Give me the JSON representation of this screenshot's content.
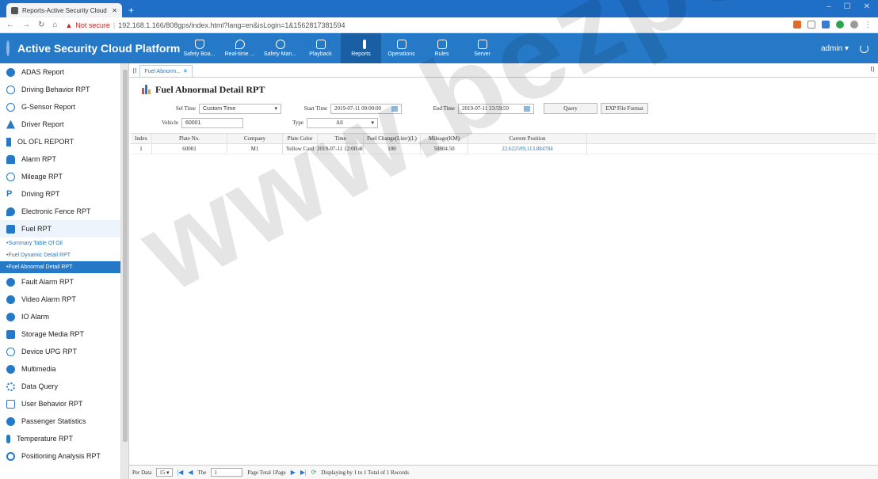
{
  "browser": {
    "tab_title": "Reports-Active Security Cloud",
    "url_warning": "Not secure",
    "url": "192.168.1.166/808gps/index.html?lang=en&isLogin=1&1562817381594"
  },
  "header": {
    "brand": "Active Security Cloud Platform",
    "nav": [
      {
        "label": "Safety Boa..."
      },
      {
        "label": "Real-time ..."
      },
      {
        "label": "Safety Man..."
      },
      {
        "label": "Playback"
      },
      {
        "label": "Reports"
      },
      {
        "label": "Operations"
      },
      {
        "label": "Rules"
      },
      {
        "label": "Server"
      }
    ],
    "user": "admin"
  },
  "sidebar": {
    "items": [
      {
        "label": "ADAS Report"
      },
      {
        "label": "Driving Behavior RPT"
      },
      {
        "label": "G-Sensor Report"
      },
      {
        "label": "Driver Report"
      },
      {
        "label": "OL OFL REPORT"
      },
      {
        "label": "Alarm RPT"
      },
      {
        "label": "Mileage RPT"
      },
      {
        "label": "Driving RPT"
      },
      {
        "label": "Electronic Fence RPT"
      },
      {
        "label": "Fuel RPT"
      }
    ],
    "fuel_sub": [
      {
        "label": "Summary Table Of Oil"
      },
      {
        "label": "Fuel Dynamic Detail RPT"
      },
      {
        "label": "Fuel Abnormal Detail RPT"
      }
    ],
    "items2": [
      {
        "label": "Fault Alarm RPT"
      },
      {
        "label": "Video Alarm RPT"
      },
      {
        "label": "IO Alarm"
      },
      {
        "label": "Storage Media RPT"
      },
      {
        "label": "Device UPG RPT"
      },
      {
        "label": "Multimedia"
      },
      {
        "label": "Data Query"
      },
      {
        "label": "User Behavior RPT"
      },
      {
        "label": "Passenger Statistics"
      },
      {
        "label": "Temperature RPT"
      },
      {
        "label": "Positioning Analysis RPT"
      }
    ]
  },
  "page_tab": "Fuel Abnorm...",
  "report": {
    "title": "Fuel Abnormal Detail RPT",
    "sel_time_label": "Sel Time",
    "sel_time_value": "Custom Time",
    "start_label": "Start Time",
    "start_value": "2019-07-11 00:00:00",
    "end_label": "End Time",
    "end_value": "2019-07-11 23:59:59",
    "query": "Query",
    "export": "EXP File Format",
    "vehicle_label": "Vehicle",
    "vehicle_value": "60001",
    "type_label": "Type",
    "type_value": "All"
  },
  "table": {
    "headers": [
      "Index",
      "Plate No.",
      "Company",
      "Plate Color",
      "Time",
      "Fuel Change(Liter)(L)",
      "Mileage(KM)",
      "Current Position"
    ],
    "rows": [
      [
        "1",
        "60001",
        "M1",
        "Yellow Card",
        "2019-07-11 12:00:46",
        "100",
        "50804.50",
        "22.622599,113.884784"
      ]
    ]
  },
  "pager": {
    "per_data": "Per Data",
    "per_value": "15",
    "the": "The",
    "page_value": "1",
    "page_total": "Page Total 1Page",
    "displaying": "Displaying by 1 to 1 Total of 1 Records"
  },
  "watermark": "www.bezpeka"
}
